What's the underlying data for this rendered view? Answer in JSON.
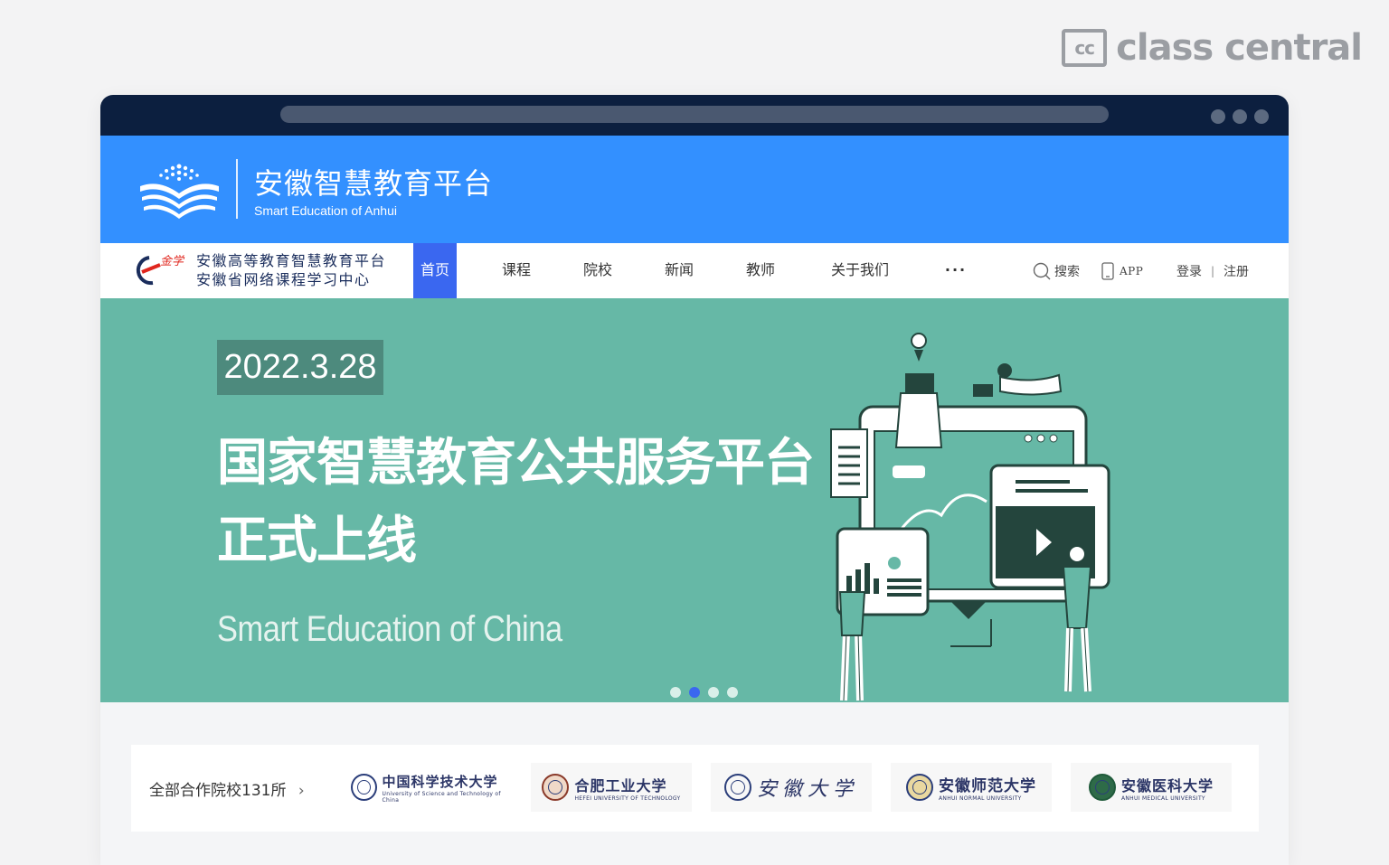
{
  "watermark": {
    "icon": "cc",
    "text": "class central"
  },
  "header": {
    "title": "安徽智慧教育平台",
    "subtitle": "Smart Education of Anhui"
  },
  "nav": {
    "brand_line1": "安徽高等教育智慧教育平台",
    "brand_line2": "安徽省网络课程学习中心",
    "items": [
      {
        "label": "首页",
        "active": true
      },
      {
        "label": "课程"
      },
      {
        "label": "院校"
      },
      {
        "label": "新闻"
      },
      {
        "label": "教师"
      },
      {
        "label": "关于我们"
      },
      {
        "label": "···"
      }
    ],
    "search_label": "搜索",
    "app_label": "APP",
    "login_label": "登录",
    "separator": "|",
    "register_label": "注册"
  },
  "banner": {
    "date": "2022.3.28",
    "title_line1": "国家智慧教育公共服务平台",
    "title_line2": "正式上线",
    "english": "Smart Education of China",
    "slides": 4,
    "active_slide": 2,
    "bg_color": "#66b8a6"
  },
  "schools": {
    "label": "全部合作院校131所",
    "chevron": "›",
    "items": [
      {
        "cn": "中国科学技术大学",
        "en": "University of Science and Technology of China",
        "seal_color": "#2b3e7a"
      },
      {
        "cn": "合肥工业大学",
        "en": "HEFEI UNIVERSITY OF TECHNOLOGY",
        "seal_color": "#8a3a2a"
      },
      {
        "cn": "安徽大学",
        "en": "",
        "seal_color": "#2b3e7a"
      },
      {
        "cn": "安徽师范大学",
        "en": "ANHUI NORMAL UNIVERSITY",
        "seal_color": "#2b3e7a"
      },
      {
        "cn": "安徽医科大学",
        "en": "ANHUI MEDICAL UNIVERSITY",
        "seal_color": "#1f5a3a"
      }
    ]
  }
}
